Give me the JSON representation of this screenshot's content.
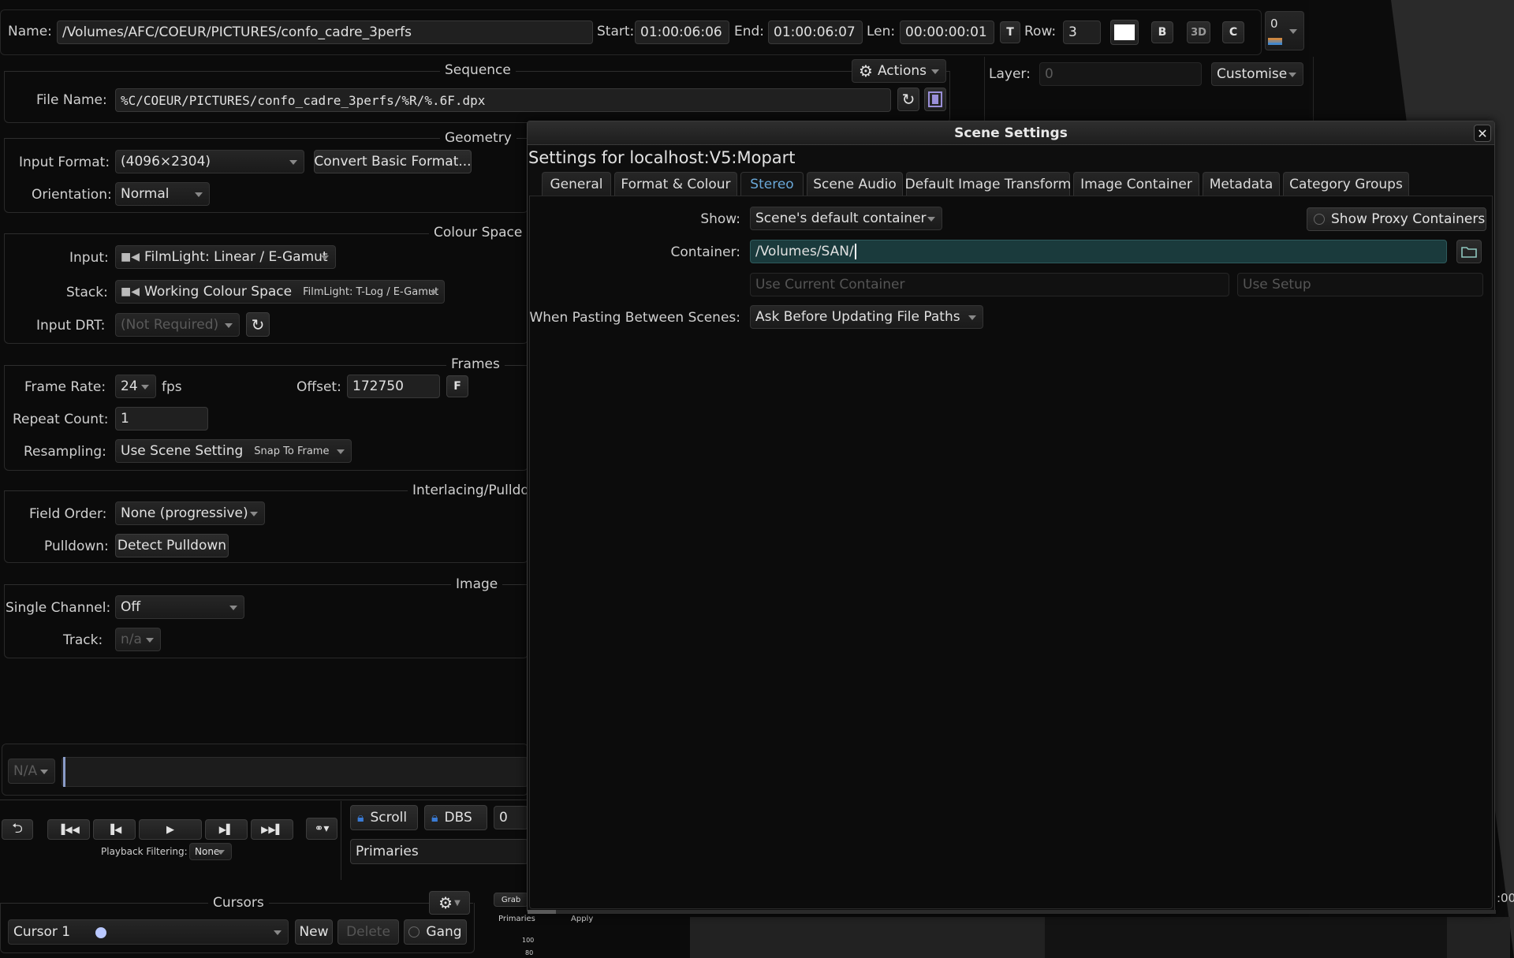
{
  "top": {
    "name_label": "Name:",
    "name_value": "/Volumes/AFC/COEUR/PICTURES/confo_cadre_3perfs",
    "start_label": "Start:",
    "start_value": "01:00:06:06",
    "end_label": "End:",
    "end_value": "01:00:06:07",
    "len_label": "Len:",
    "len_value": "00:00:00:01",
    "row_label": "Row:",
    "row_value": "3",
    "btn_t": "T",
    "btn_b": "B",
    "btn_3d": "3D",
    "btn_c": "C",
    "counter_value": "0"
  },
  "layer": {
    "label": "Layer:",
    "value": "0",
    "customise": "Customise"
  },
  "sequence": {
    "title": "Sequence",
    "actions": "Actions",
    "file_name_label": "File Name:",
    "file_name_value": "%C/COEUR/PICTURES/confo_cadre_3perfs/%R/%.6F.dpx"
  },
  "geometry": {
    "title": "Geometry",
    "input_format_label": "Input Format:",
    "input_format_value": "(4096×2304)",
    "convert_btn": "Convert Basic Format...",
    "orientation_label": "Orientation:",
    "orientation_value": "Normal"
  },
  "colour_space": {
    "title": "Colour Space",
    "input_label": "Input:",
    "input_value": "FilmLight: Linear / E-Gamut",
    "stack_label": "Stack:",
    "stack_value": "Working Colour Space",
    "stack_sub": "FilmLight: T-Log / E-Gamut",
    "drt_label": "Input DRT:",
    "drt_value": "(Not Required)"
  },
  "frames": {
    "title": "Frames",
    "rate_label": "Frame Rate:",
    "rate_value": "24",
    "fps": "fps",
    "offset_label": "Offset:",
    "offset_value": "172750",
    "offset_btn": "F",
    "repeat_label": "Repeat Count:",
    "repeat_value": "1",
    "resampling_label": "Resampling:",
    "resampling_value": "Use Scene Setting",
    "resampling_sub": "Snap To Frame"
  },
  "interlacing": {
    "title": "Interlacing/Pulldov",
    "field_order_label": "Field Order:",
    "field_order_value": "None (progressive)",
    "pulldown_label": "Pulldown:",
    "pulldown_btn": "Detect Pulldown"
  },
  "image": {
    "title": "Image",
    "single_channel_label": "Single Channel:",
    "single_channel_value": "Off",
    "track_label": "Track:",
    "track_value": "n/a"
  },
  "timeline": {
    "na_value": "N/A"
  },
  "transport": {
    "scroll": "Scroll",
    "dbs": "DBS",
    "dbs_value": "0",
    "playback_filtering_label": "Playback Filtering:",
    "playback_filtering_value": "None",
    "primaries": "Primaries"
  },
  "cursors": {
    "title": "Cursors",
    "cursor_value": "Cursor 1",
    "new_btn": "New",
    "delete_btn": "Delete",
    "gang_btn": "Gang"
  },
  "mini_panel": {
    "grab": "Grab",
    "primaries": "Primaries",
    "apply": "Apply",
    "tick_100": "100",
    "tick_80": "80"
  },
  "right_edge": {
    "fragment": ":00"
  },
  "dialog": {
    "title": "Scene Settings",
    "heading": "Settings for localhost:V5:Mopart",
    "tabs": [
      {
        "label": "General"
      },
      {
        "label": "Format & Colour"
      },
      {
        "label": "Stereo"
      },
      {
        "label": "Scene Audio"
      },
      {
        "label": "Default Image Transform"
      },
      {
        "label": "Image Container"
      },
      {
        "label": "Metadata"
      },
      {
        "label": "Category Groups"
      }
    ],
    "show_label": "Show:",
    "show_value": "Scene's default container",
    "show_proxy": "Show Proxy Containers",
    "container_label": "Container:",
    "container_value": "/Volumes/SAN/",
    "use_current_btn": "Use Current Container",
    "use_setup_btn": "Use Setup",
    "pasting_label": "When Pasting Between Scenes:",
    "pasting_value": "Ask Before Updating File Paths"
  },
  "colors": {
    "accent_blue": "#3a7bd5",
    "active_tab": "#6aa8d8",
    "dialog_bg": "#0e0e0e"
  }
}
